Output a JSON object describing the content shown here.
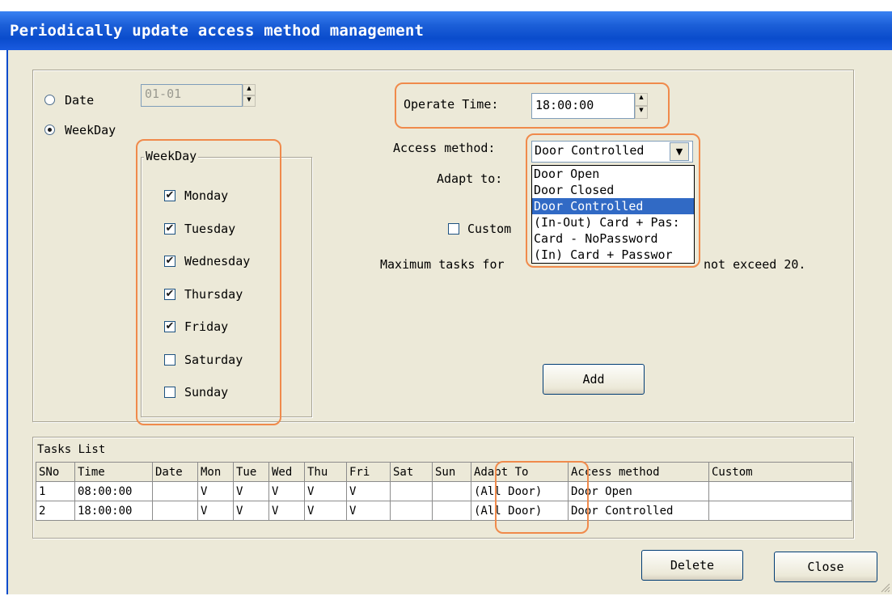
{
  "window": {
    "title": "Periodically update access method management"
  },
  "schedule": {
    "date_label": "Date",
    "date_value": "01-01",
    "date_selected": false,
    "weekday_label": "WeekDay",
    "weekday_selected": true
  },
  "weekday_group": {
    "label": "WeekDay",
    "days": [
      {
        "label": "Monday",
        "checked": true
      },
      {
        "label": "Tuesday",
        "checked": true
      },
      {
        "label": "Wednesday",
        "checked": true
      },
      {
        "label": "Thursday",
        "checked": true
      },
      {
        "label": "Friday",
        "checked": true
      },
      {
        "label": "Saturday",
        "checked": false
      },
      {
        "label": "Sunday",
        "checked": false
      }
    ]
  },
  "operate_time": {
    "label": "Operate Time:",
    "value": "18:00:00"
  },
  "access_method": {
    "label": "Access method:",
    "selected": "Door Controlled",
    "options": [
      "Door Open",
      "Door Closed",
      "Door Controlled",
      "(In-Out) Card + Pas:",
      "Card - NoPassword",
      "(In) Card + Passwor"
    ],
    "selected_index": 2
  },
  "adapt_to": {
    "label": "Adapt to:"
  },
  "custom": {
    "label": "Custom",
    "checked": false
  },
  "note": {
    "visible_text": "Maximum tasks for",
    "visible_tail": "not exceed 20."
  },
  "buttons": {
    "add": "Add",
    "delete": "Delete",
    "close": "Close"
  },
  "tasks": {
    "title": "Tasks List",
    "columns": [
      "SNo",
      "Time",
      "Date",
      "Mon",
      "Tue",
      "Wed",
      "Thu",
      "Fri",
      "Sat",
      "Sun",
      "Adapt To",
      "Access method",
      "Custom"
    ],
    "rows": [
      [
        "1",
        "08:00:00",
        "",
        "V",
        "V",
        "V",
        "V",
        "V",
        "",
        "",
        "(All Door)",
        "Door Open",
        ""
      ],
      [
        "2",
        "18:00:00",
        "",
        "V",
        "V",
        "V",
        "V",
        "V",
        "",
        "",
        "(All Door)",
        "Door Controlled",
        ""
      ]
    ]
  },
  "colors": {
    "title_bar": "#0a4ccc",
    "highlight": "#f08a4b",
    "selection": "#316ac5",
    "face": "#ece9d8"
  }
}
